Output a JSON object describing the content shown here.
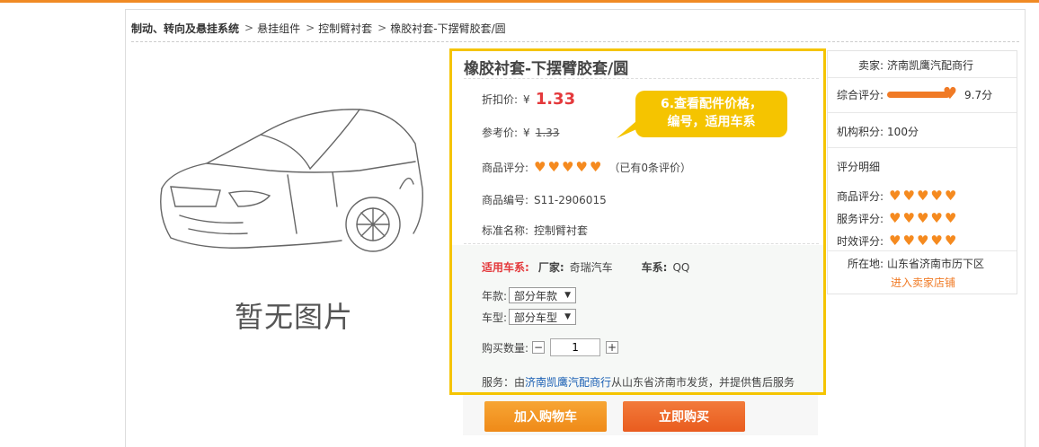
{
  "breadcrumb": {
    "items": [
      "制动、转向及悬挂系统",
      "悬挂组件",
      "控制臂衬套",
      "橡胶衬套-下摆臂胶套/圆"
    ],
    "separator": ">"
  },
  "image": {
    "placeholder_text": "暂无图片"
  },
  "product": {
    "title": "橡胶衬套-下摆臂胶套/圆",
    "discount_label": "折扣价:",
    "currency": "¥",
    "discount_price": "1.33",
    "ref_label": "参考价:",
    "ref_price": "1.33",
    "rating_label": "商品评分:",
    "rating_count": "（已有0条评价）",
    "code_label": "商品编号:",
    "code": "S11-2906015",
    "std_label": "标准名称:",
    "std_name": "控制臂衬套",
    "fit_label": "适用车系:",
    "maker_label": "厂家:",
    "maker": "奇瑞汽车",
    "series_label": "车系:",
    "series": "QQ",
    "year_label": "年款:",
    "year_value": "部分年款",
    "model_label": "车型:",
    "model_value": "部分车型",
    "qty_label": "购买数量:",
    "qty_value": "1",
    "service_prefix": "服务：由",
    "service_seller": "济南凯鹰汽配商行",
    "service_suffix": "从山东省济南市发货，并提供售后服务"
  },
  "callout": {
    "line1": "6.查看配件价格，",
    "line2": "编号，适用车系"
  },
  "buttons": {
    "cart": "加入购物车",
    "buy": "立即购买"
  },
  "seller": {
    "name_label": "卖家:",
    "name": "济南凯鹰汽配商行",
    "overall_label": "综合评分:",
    "overall_score": "9.7分",
    "org_label": "机构积分:",
    "org_score": "100分",
    "detail_title": "评分明细",
    "goods_label": "商品评分:",
    "service_label": "服务评分:",
    "timely_label": "时效评分:",
    "location_label": "所在地:",
    "location": "山东省济南市历下区",
    "enter_store": "进入卖家店铺"
  },
  "colors": {
    "accent": "#f08a24",
    "highlight": "#f5c400",
    "price": "#e4393c"
  }
}
